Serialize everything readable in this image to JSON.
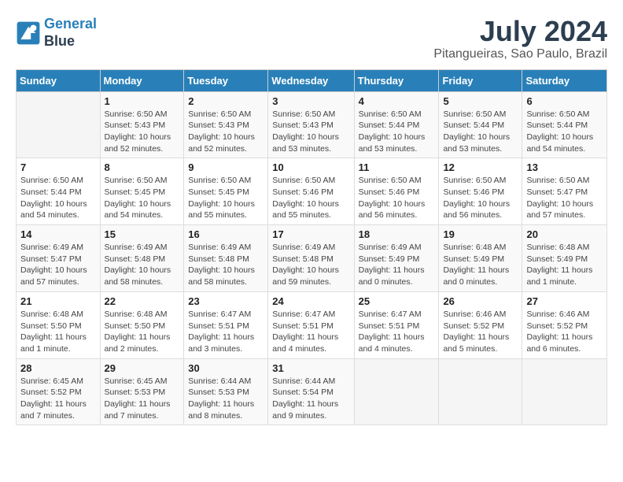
{
  "header": {
    "logo_line1": "General",
    "logo_line2": "Blue",
    "title": "July 2024",
    "location": "Pitangueiras, Sao Paulo, Brazil"
  },
  "weekdays": [
    "Sunday",
    "Monday",
    "Tuesday",
    "Wednesday",
    "Thursday",
    "Friday",
    "Saturday"
  ],
  "weeks": [
    [
      {
        "day": "",
        "info": ""
      },
      {
        "day": "1",
        "info": "Sunrise: 6:50 AM\nSunset: 5:43 PM\nDaylight: 10 hours\nand 52 minutes."
      },
      {
        "day": "2",
        "info": "Sunrise: 6:50 AM\nSunset: 5:43 PM\nDaylight: 10 hours\nand 52 minutes."
      },
      {
        "day": "3",
        "info": "Sunrise: 6:50 AM\nSunset: 5:43 PM\nDaylight: 10 hours\nand 53 minutes."
      },
      {
        "day": "4",
        "info": "Sunrise: 6:50 AM\nSunset: 5:44 PM\nDaylight: 10 hours\nand 53 minutes."
      },
      {
        "day": "5",
        "info": "Sunrise: 6:50 AM\nSunset: 5:44 PM\nDaylight: 10 hours\nand 53 minutes."
      },
      {
        "day": "6",
        "info": "Sunrise: 6:50 AM\nSunset: 5:44 PM\nDaylight: 10 hours\nand 54 minutes."
      }
    ],
    [
      {
        "day": "7",
        "info": "Sunrise: 6:50 AM\nSunset: 5:44 PM\nDaylight: 10 hours\nand 54 minutes."
      },
      {
        "day": "8",
        "info": "Sunrise: 6:50 AM\nSunset: 5:45 PM\nDaylight: 10 hours\nand 54 minutes."
      },
      {
        "day": "9",
        "info": "Sunrise: 6:50 AM\nSunset: 5:45 PM\nDaylight: 10 hours\nand 55 minutes."
      },
      {
        "day": "10",
        "info": "Sunrise: 6:50 AM\nSunset: 5:46 PM\nDaylight: 10 hours\nand 55 minutes."
      },
      {
        "day": "11",
        "info": "Sunrise: 6:50 AM\nSunset: 5:46 PM\nDaylight: 10 hours\nand 56 minutes."
      },
      {
        "day": "12",
        "info": "Sunrise: 6:50 AM\nSunset: 5:46 PM\nDaylight: 10 hours\nand 56 minutes."
      },
      {
        "day": "13",
        "info": "Sunrise: 6:50 AM\nSunset: 5:47 PM\nDaylight: 10 hours\nand 57 minutes."
      }
    ],
    [
      {
        "day": "14",
        "info": "Sunrise: 6:49 AM\nSunset: 5:47 PM\nDaylight: 10 hours\nand 57 minutes."
      },
      {
        "day": "15",
        "info": "Sunrise: 6:49 AM\nSunset: 5:48 PM\nDaylight: 10 hours\nand 58 minutes."
      },
      {
        "day": "16",
        "info": "Sunrise: 6:49 AM\nSunset: 5:48 PM\nDaylight: 10 hours\nand 58 minutes."
      },
      {
        "day": "17",
        "info": "Sunrise: 6:49 AM\nSunset: 5:48 PM\nDaylight: 10 hours\nand 59 minutes."
      },
      {
        "day": "18",
        "info": "Sunrise: 6:49 AM\nSunset: 5:49 PM\nDaylight: 11 hours\nand 0 minutes."
      },
      {
        "day": "19",
        "info": "Sunrise: 6:48 AM\nSunset: 5:49 PM\nDaylight: 11 hours\nand 0 minutes."
      },
      {
        "day": "20",
        "info": "Sunrise: 6:48 AM\nSunset: 5:49 PM\nDaylight: 11 hours\nand 1 minute."
      }
    ],
    [
      {
        "day": "21",
        "info": "Sunrise: 6:48 AM\nSunset: 5:50 PM\nDaylight: 11 hours\nand 1 minute."
      },
      {
        "day": "22",
        "info": "Sunrise: 6:48 AM\nSunset: 5:50 PM\nDaylight: 11 hours\nand 2 minutes."
      },
      {
        "day": "23",
        "info": "Sunrise: 6:47 AM\nSunset: 5:51 PM\nDaylight: 11 hours\nand 3 minutes."
      },
      {
        "day": "24",
        "info": "Sunrise: 6:47 AM\nSunset: 5:51 PM\nDaylight: 11 hours\nand 4 minutes."
      },
      {
        "day": "25",
        "info": "Sunrise: 6:47 AM\nSunset: 5:51 PM\nDaylight: 11 hours\nand 4 minutes."
      },
      {
        "day": "26",
        "info": "Sunrise: 6:46 AM\nSunset: 5:52 PM\nDaylight: 11 hours\nand 5 minutes."
      },
      {
        "day": "27",
        "info": "Sunrise: 6:46 AM\nSunset: 5:52 PM\nDaylight: 11 hours\nand 6 minutes."
      }
    ],
    [
      {
        "day": "28",
        "info": "Sunrise: 6:45 AM\nSunset: 5:52 PM\nDaylight: 11 hours\nand 7 minutes."
      },
      {
        "day": "29",
        "info": "Sunrise: 6:45 AM\nSunset: 5:53 PM\nDaylight: 11 hours\nand 7 minutes."
      },
      {
        "day": "30",
        "info": "Sunrise: 6:44 AM\nSunset: 5:53 PM\nDaylight: 11 hours\nand 8 minutes."
      },
      {
        "day": "31",
        "info": "Sunrise: 6:44 AM\nSunset: 5:54 PM\nDaylight: 11 hours\nand 9 minutes."
      },
      {
        "day": "",
        "info": ""
      },
      {
        "day": "",
        "info": ""
      },
      {
        "day": "",
        "info": ""
      }
    ]
  ]
}
